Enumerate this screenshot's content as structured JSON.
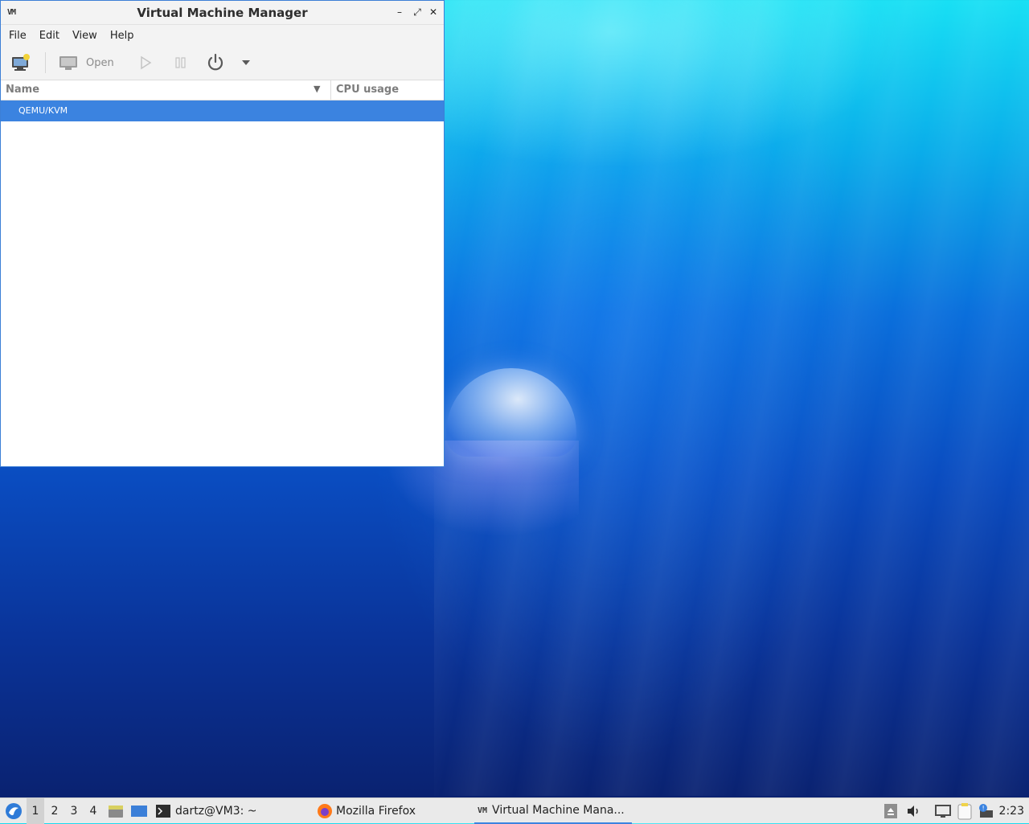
{
  "window": {
    "title": "Virtual Machine Manager",
    "app_icon_text": "VM",
    "controls": {
      "minimize": "–",
      "maximize": "⤢",
      "close": "✕"
    }
  },
  "menubar": {
    "items": [
      "File",
      "Edit",
      "View",
      "Help"
    ]
  },
  "toolbar": {
    "open_label": "Open"
  },
  "table": {
    "columns": {
      "name": "Name",
      "cpu": "CPU usage"
    },
    "rows": [
      {
        "label": "QEMU/KVM",
        "selected": true
      }
    ]
  },
  "taskbar": {
    "workspaces": [
      "1",
      "2",
      "3",
      "4"
    ],
    "active_workspace": "1",
    "tasks": [
      {
        "label": "dartz@VM3: ~",
        "icon": "terminal-icon"
      },
      {
        "label": "Mozilla Firefox",
        "icon": "firefox-icon"
      },
      {
        "label": "Virtual Machine Mana...",
        "icon": "virt-manager-icon",
        "active": true
      }
    ],
    "clock": "2:23"
  },
  "colors": {
    "selection": "#3b83e0",
    "window_border": "#3c7fd6"
  }
}
